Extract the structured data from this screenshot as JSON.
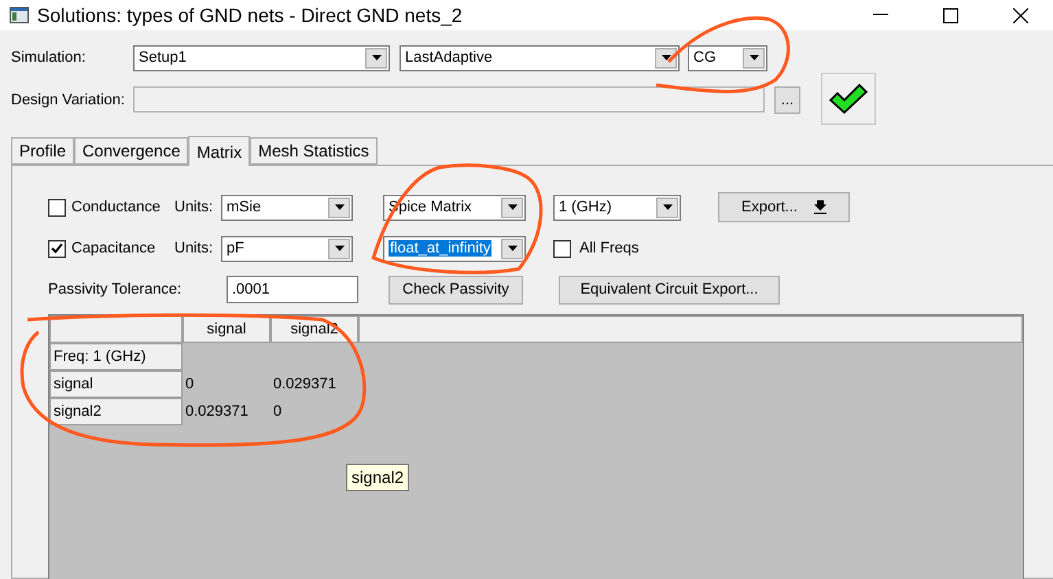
{
  "window": {
    "title": "Solutions: types of GND nets - Direct GND nets_2"
  },
  "simulation": {
    "label": "Simulation:",
    "setup": "Setup1",
    "solution": "LastAdaptive",
    "quantity": "CG"
  },
  "design_variation": {
    "label": "Design Variation:",
    "button": "..."
  },
  "tabs": [
    {
      "label": "Profile",
      "selected": false
    },
    {
      "label": "Convergence",
      "selected": false
    },
    {
      "label": "Matrix",
      "selected": true
    },
    {
      "label": "Mesh Statistics",
      "selected": false
    }
  ],
  "quantities": [
    {
      "label": "Conductance",
      "checked": false,
      "units_label": "Units:",
      "units": "mSie"
    },
    {
      "label": "Capacitance",
      "checked": true,
      "units_label": "Units:",
      "units": "pF"
    }
  ],
  "matrix_type": "Spice Matrix",
  "ground": {
    "value": "float_at_infinity",
    "text_selected": true
  },
  "frequency": "1 (GHz)",
  "export_button": "Export...",
  "all_freqs": {
    "label": "All Freqs",
    "checked": false
  },
  "passivity": {
    "label": "Passivity Tolerance:",
    "value": ".0001",
    "button": "Check Passivity"
  },
  "equivalent_button": "Equivalent Circuit Export...",
  "table": {
    "columns": [
      "signal",
      "signal2"
    ],
    "freq_label": "Freq: 1 (GHz)",
    "rows": [
      {
        "name": "signal",
        "cells": [
          "0",
          "0.029371"
        ]
      },
      {
        "name": "signal2",
        "cells": [
          "0.029371",
          "0"
        ]
      }
    ]
  },
  "tooltip": "signal2"
}
